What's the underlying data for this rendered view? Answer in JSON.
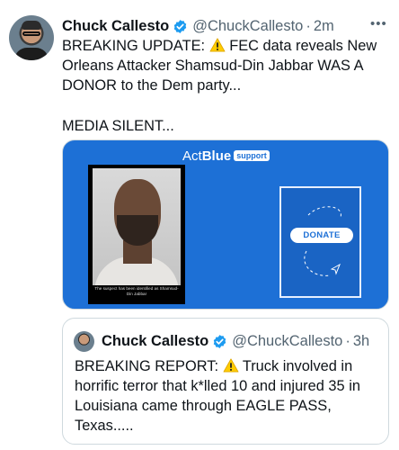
{
  "tweet": {
    "author_name": "Chuck Callesto",
    "handle": "@ChuckCallesto",
    "separator": "·",
    "time": "2m",
    "more_label": "•••",
    "text_line1_before": "BREAKING UPDATE: ",
    "text_line1_after": " FEC data reveals New Orleans Attacker Shamsud-Din Jabbar WAS A DONOR to the Dem party...",
    "text_line2": "MEDIA SILENT...",
    "warning_icon": "warning-emoji"
  },
  "media": {
    "logo_act": "Act",
    "logo_blue": "Blue",
    "logo_badge": "support",
    "photo_caption": "The suspect has been identified as Shamsud-Din Jabbar",
    "donate_label": "DONATE",
    "brand_color": "#1d70d6"
  },
  "quoted": {
    "author_name": "Chuck Callesto",
    "handle": "@ChuckCallesto",
    "separator": "·",
    "time": "3h",
    "text_before": "BREAKING REPORT: ",
    "text_after": " Truck involved in horrific terror that k*lled 10 and injured 35 in Louisiana came through EAGLE PASS, Texas....."
  },
  "colors": {
    "text": "#0f1419",
    "secondary": "#536471",
    "verified": "#1d9bf0",
    "border": "#cfd9de"
  }
}
